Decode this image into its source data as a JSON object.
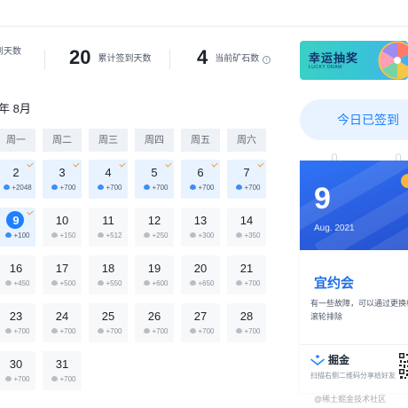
{
  "stats": [
    {
      "value": "",
      "label": "到天数"
    },
    {
      "value": "20",
      "label": "累计签到天数"
    },
    {
      "value": "4",
      "label": "当前矿石数"
    }
  ],
  "stats_info_icon": "info-circle-icon",
  "banner": {
    "title": "幸运抽奖",
    "subtitle": "LUCKY DRAW"
  },
  "calendar": {
    "month_title": "年 8月",
    "weekdays": [
      "周一",
      "周二",
      "周三",
      "周四",
      "周五",
      "周六"
    ],
    "days": [
      {
        "day": "2",
        "reward": "+2048",
        "signed": true
      },
      {
        "day": "3",
        "reward": "+700",
        "signed": true
      },
      {
        "day": "4",
        "reward": "+700",
        "signed": true
      },
      {
        "day": "5",
        "reward": "+700",
        "signed": true
      },
      {
        "day": "6",
        "reward": "+700",
        "signed": true
      },
      {
        "day": "7",
        "reward": "+700",
        "signed": true
      },
      {
        "day": "9",
        "reward": "+100",
        "signed": true,
        "today": true
      },
      {
        "day": "10",
        "reward": "+150",
        "signed": false
      },
      {
        "day": "11",
        "reward": "+512",
        "signed": false
      },
      {
        "day": "12",
        "reward": "+250",
        "signed": false
      },
      {
        "day": "13",
        "reward": "+300",
        "signed": false
      },
      {
        "day": "14",
        "reward": "+350",
        "signed": false
      },
      {
        "day": "16",
        "reward": "+450",
        "signed": false
      },
      {
        "day": "17",
        "reward": "+500",
        "signed": false
      },
      {
        "day": "18",
        "reward": "+550",
        "signed": false
      },
      {
        "day": "19",
        "reward": "+600",
        "signed": false
      },
      {
        "day": "20",
        "reward": "+650",
        "signed": false
      },
      {
        "day": "21",
        "reward": "+700",
        "signed": false
      },
      {
        "day": "23",
        "reward": "+700",
        "signed": false
      },
      {
        "day": "24",
        "reward": "+700",
        "signed": false
      },
      {
        "day": "25",
        "reward": "+700",
        "signed": false
      },
      {
        "day": "26",
        "reward": "+700",
        "signed": false
      },
      {
        "day": "27",
        "reward": "+700",
        "signed": false
      },
      {
        "day": "28",
        "reward": "+700",
        "signed": false
      },
      {
        "day": "30",
        "reward": "+700",
        "signed": false
      },
      {
        "day": "31",
        "reward": "+700",
        "signed": false
      }
    ],
    "gem_icon": "ore-gem-icon",
    "check_icon": "signed-check-icon"
  },
  "signed_button": "今日已签到",
  "share_card": {
    "day": "9",
    "date": "Aug. 2021",
    "luck": "宜约会",
    "desc": "有一些故障，可以通过更换标滚轮排除",
    "brand": "掘金",
    "share_hint": "扫描右侧二维码分享给好友"
  },
  "watermark": "@稀土掘金技术社区",
  "colors": {
    "accent": "#1e80ff",
    "signed_bg": "#e8f3ff",
    "check": "#f29a2e"
  }
}
